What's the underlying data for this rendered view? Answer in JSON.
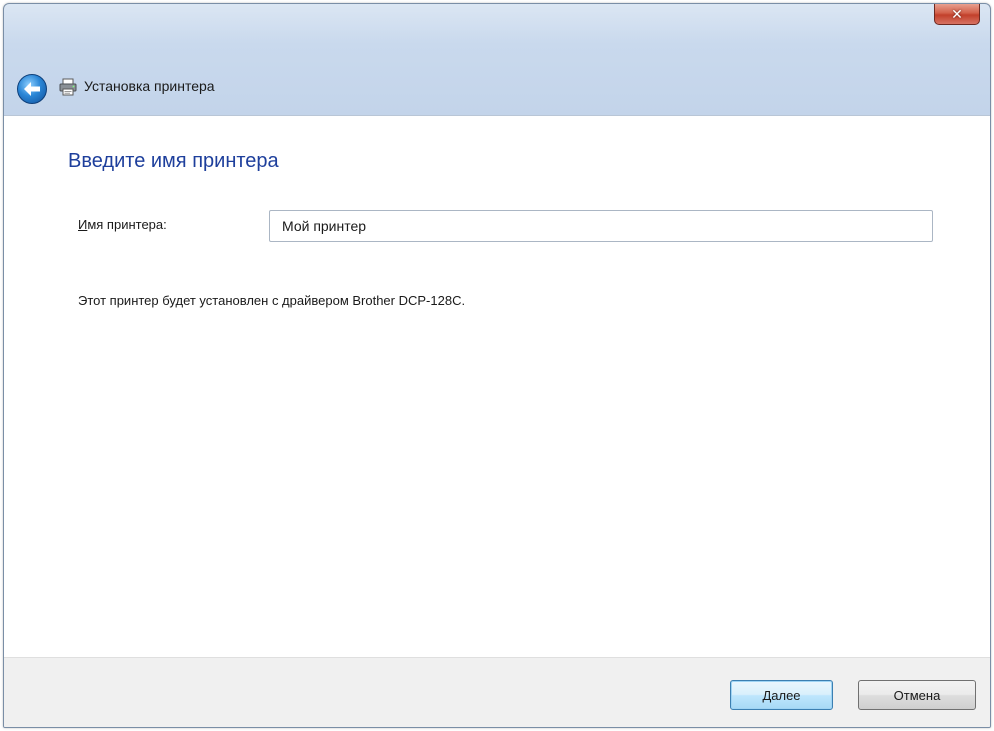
{
  "window": {
    "title": "Установка принтера",
    "close_label": "✕"
  },
  "main": {
    "heading": "Введите имя принтера",
    "printer_name_label_mnemonic": "И",
    "printer_name_label_rest": "мя принтера:",
    "printer_name_value": "Мой принтер",
    "info_text": "Этот принтер будет установлен с драйвером Brother DCP-128C."
  },
  "footer": {
    "next_mnemonic": "Д",
    "next_rest": "алее",
    "cancel_label": "Отмена"
  },
  "icons": {
    "back": "back-arrow-icon",
    "printer": "printer-icon",
    "close": "close-icon"
  },
  "colors": {
    "heading": "#1e3f9c",
    "close_button": "#c2402b",
    "back_button": "#2a86d6",
    "default_button_border": "#3c7fb1"
  }
}
